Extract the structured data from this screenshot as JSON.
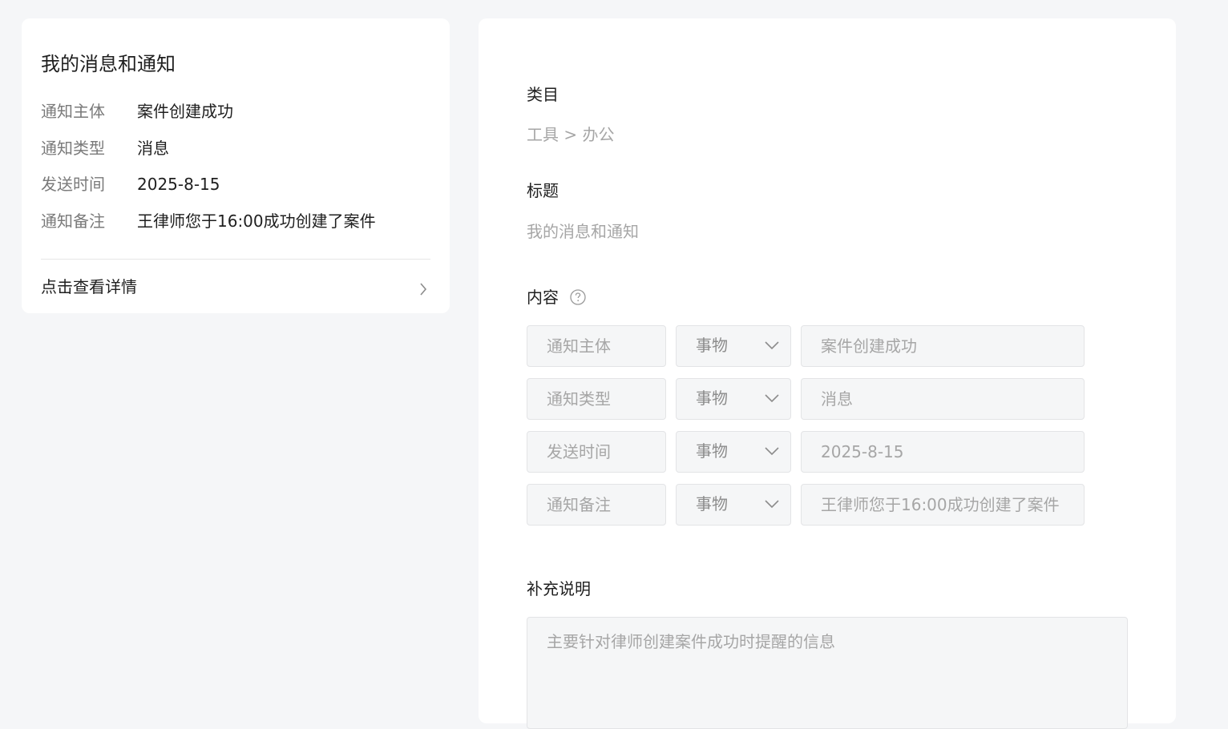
{
  "preview": {
    "title": "我的消息和通知",
    "rows": [
      {
        "key": "通知主体",
        "value": "案件创建成功"
      },
      {
        "key": "通知类型",
        "value": "消息"
      },
      {
        "key": "发送时间",
        "value": "2025-8-15"
      },
      {
        "key": "通知备注",
        "value": "王律师您于16:00成功创建了案件"
      }
    ],
    "detail_link": "点击查看详情"
  },
  "form": {
    "category": {
      "label": "类目",
      "value": "工具 > 办公"
    },
    "title": {
      "label": "标题",
      "value": "我的消息和通知"
    },
    "content": {
      "label": "内容",
      "rows": [
        {
          "name": "通知主体",
          "type": "事物",
          "value": "案件创建成功"
        },
        {
          "name": "通知类型",
          "type": "事物",
          "value": "消息"
        },
        {
          "name": "发送时间",
          "type": "事物",
          "value": "2025-8-15"
        },
        {
          "name": "通知备注",
          "type": "事物",
          "value": "王律师您于16:00成功创建了案件"
        }
      ]
    },
    "supplement": {
      "label": "补充说明",
      "value": "主要针对律师创建案件成功时提醒的信息"
    }
  },
  "icons": {
    "help": "question-circle-icon",
    "chevron": "chevron-right-icon",
    "caret": "chevron-down-icon"
  }
}
